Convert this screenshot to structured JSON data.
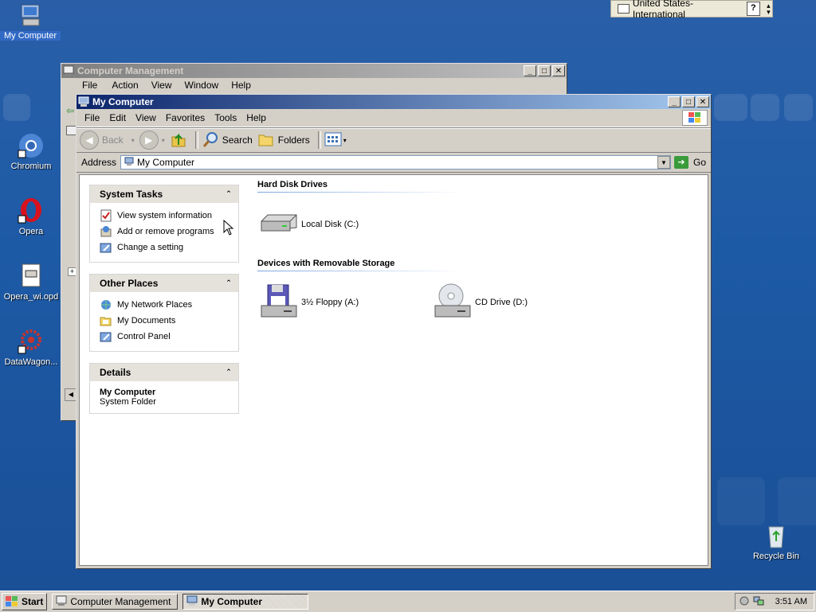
{
  "desktop": {
    "icons": [
      {
        "label": "My Computer",
        "icon": "my-computer-icon"
      },
      {
        "label": "Chromium",
        "icon": "chromium-icon"
      },
      {
        "label": "Opera",
        "icon": "opera-icon"
      },
      {
        "label": "Opera_wi.opd",
        "icon": "file-icon"
      },
      {
        "label": "DataWagon...",
        "icon": "datawagon-icon"
      },
      {
        "label": "Recycle Bin",
        "icon": "recycle-bin-icon"
      }
    ]
  },
  "langbar": {
    "language": "United States-International",
    "help": "?"
  },
  "bg_window": {
    "title": "Computer Management",
    "menu": [
      "File",
      "Action",
      "View",
      "Window",
      "Help"
    ]
  },
  "window": {
    "title": "My Computer",
    "menu": [
      "File",
      "Edit",
      "View",
      "Favorites",
      "Tools",
      "Help"
    ],
    "toolbar": {
      "back": "Back",
      "search": "Search",
      "folders": "Folders"
    },
    "address": {
      "label": "Address",
      "value": "My Computer",
      "go": "Go"
    },
    "taskpane": {
      "system_tasks": {
        "title": "System Tasks",
        "items": [
          "View system information",
          "Add or remove programs",
          "Change a setting"
        ]
      },
      "other_places": {
        "title": "Other Places",
        "items": [
          "My Network Places",
          "My Documents",
          "Control Panel"
        ]
      },
      "details": {
        "title": "Details",
        "name": "My Computer",
        "sub": "System Folder"
      }
    },
    "sections": {
      "hard_disks": {
        "title": "Hard Disk Drives",
        "items": [
          "Local Disk (C:)"
        ]
      },
      "removable": {
        "title": "Devices with Removable Storage",
        "items": [
          "3½ Floppy (A:)",
          "CD Drive (D:)"
        ]
      }
    }
  },
  "taskbar": {
    "start": "Start",
    "tasks": [
      "Computer Management",
      "My Computer"
    ],
    "clock": "3:51 AM"
  },
  "colors": {
    "desktop": "#1d5aa6",
    "title_active": "#0a246a",
    "title_inactive": "#808080"
  }
}
